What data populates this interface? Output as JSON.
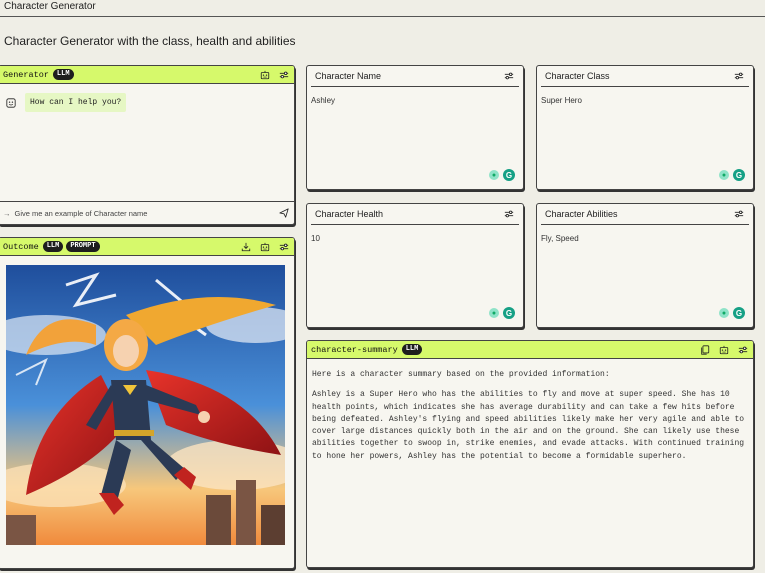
{
  "app": {
    "title": "Character Generator"
  },
  "page": {
    "title": "Character Generator with the class, health and abilities"
  },
  "generator": {
    "title": "Generator",
    "badge": "LLM",
    "message": "How can I help you?",
    "input_placeholder": "Give me an example of Character name"
  },
  "outcome": {
    "title": "Outcome",
    "badges": [
      "LLM",
      "PROMPT"
    ],
    "image_description": "superhero-illustration"
  },
  "fields": {
    "name": {
      "label": "Character Name",
      "value": "Ashley"
    },
    "class": {
      "label": "Character Class",
      "value": "Super Hero"
    },
    "health": {
      "label": "Character Health",
      "value": "10"
    },
    "abilities": {
      "label": "Character Abilities",
      "value": "Fly, Speed"
    }
  },
  "summary": {
    "title": "character-summary",
    "badge": "LLM",
    "intro": "Here is a character summary based on the provided information:",
    "body": "Ashley is a Super Hero who has the abilities to fly and move at super speed. She has 10 health points, which indicates she has average durability and can take a few hits before being defeated. Ashley's flying and speed abilities likely make her very agile and able to cover large distances quickly both in the air and on the ground. She can likely use these abilities together to swoop in, strike enemies, and evade attacks. With continued training to hone her powers, Ashley has the potential to become a formidable superhero."
  },
  "colors": {
    "accent": "#d6f96b",
    "background": "#efeee6",
    "panel": "#f7f6f0",
    "grammarly": "#16a085"
  },
  "icons": [
    "robot-icon",
    "sliders-icon",
    "smiley-icon",
    "arrow-right-icon",
    "send-icon",
    "download-icon",
    "copy-icon",
    "bulb-icon",
    "grammarly-icon"
  ]
}
